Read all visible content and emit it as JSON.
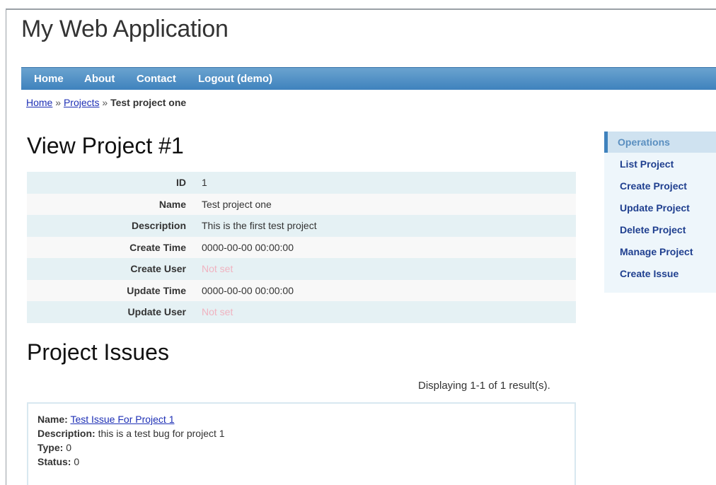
{
  "app": {
    "title": "My Web Application"
  },
  "mainmenu": {
    "items": [
      {
        "label": "Home"
      },
      {
        "label": "About"
      },
      {
        "label": "Contact"
      },
      {
        "label": "Logout (demo)"
      }
    ]
  },
  "breadcrumbs": {
    "home": "Home",
    "projects": "Projects",
    "separator": "»",
    "current": "Test project one"
  },
  "view": {
    "heading": "View Project #1",
    "rows": [
      {
        "label": "ID",
        "value": "1"
      },
      {
        "label": "Name",
        "value": "Test project one"
      },
      {
        "label": "Description",
        "value": "This is the first test project"
      },
      {
        "label": "Create Time",
        "value": "0000-00-00 00:00:00"
      },
      {
        "label": "Create User",
        "value": "Not set"
      },
      {
        "label": "Update Time",
        "value": "0000-00-00 00:00:00"
      },
      {
        "label": "Update User",
        "value": "Not set"
      }
    ]
  },
  "sidebar": {
    "title": "Operations",
    "items": [
      {
        "label": "List Project"
      },
      {
        "label": "Create Project"
      },
      {
        "label": "Update Project"
      },
      {
        "label": "Delete Project"
      },
      {
        "label": "Manage Project"
      },
      {
        "label": "Create Issue"
      }
    ]
  },
  "issues": {
    "heading": "Project Issues",
    "summary": "Displaying 1-1 of 1 result(s).",
    "list": [
      {
        "name_label": "Name:",
        "name": "Test Issue For Project 1",
        "description_label": "Description:",
        "description": "this is a test bug for project 1",
        "type_label": "Type:",
        "type": "0",
        "status_label": "Status:",
        "status": "0"
      }
    ]
  }
}
